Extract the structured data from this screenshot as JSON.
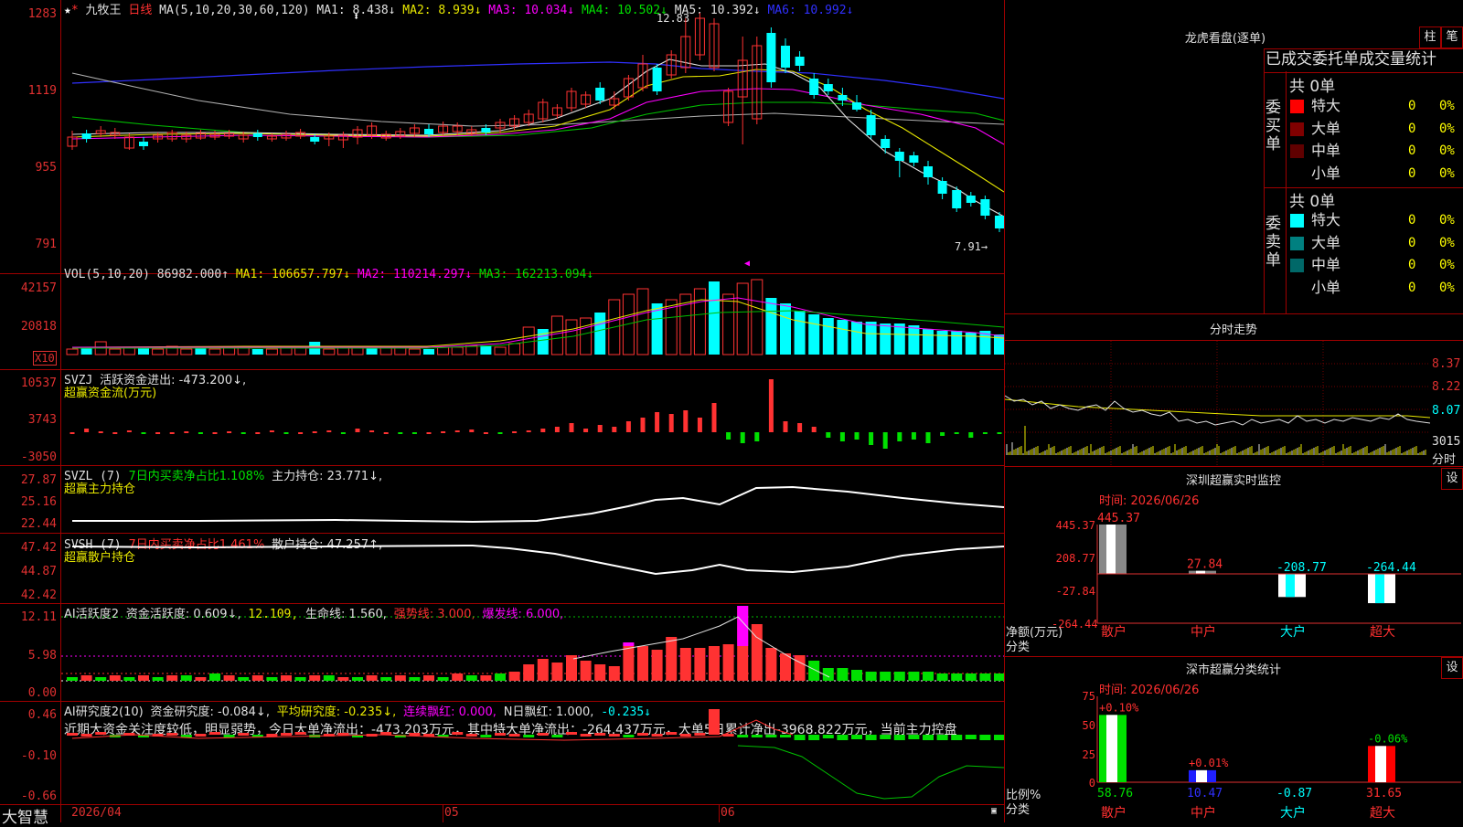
{
  "stock": {
    "name": "九牧王",
    "period": "日线"
  },
  "main": {
    "ma_params": "MA(5,10,20,30,60,120)",
    "ma1": "MA1: 8.438↓",
    "ma2": "MA2: 8.939↓",
    "ma3": "MA3: 10.034↓",
    "ma4": "MA4: 10.502↓",
    "ma5": "MA5: 10.392↓",
    "ma6": "MA6: 10.992↓",
    "y_labels": [
      "1283",
      "1119",
      "955",
      "791"
    ],
    "high_label": "12.83",
    "low_label": "7.91→"
  },
  "vol": {
    "params": "VOL(5,10,20)",
    "value": "86982.000↑",
    "ma1": "MA1: 106657.797↓",
    "ma2": "MA2: 110214.297↓",
    "ma3": "MA3: 162213.094↓",
    "y_labels": [
      "42157",
      "20818"
    ],
    "unit": "X10"
  },
  "svzj": {
    "label": "SVZJ",
    "text1": "活跃资金进出: -473.200↓,",
    "text2": "超赢资金流(万元)",
    "y_labels": [
      "10537",
      "3743",
      "-3050"
    ]
  },
  "svzl": {
    "label": "SVZL (7)",
    "text1": "7日内买卖净占比1.108%",
    "text2": "主力持仓: 23.771↓,",
    "text3": "超赢主力持仓",
    "y_labels": [
      "27.87",
      "25.16",
      "22.44"
    ]
  },
  "svsh": {
    "label": "SVSH (7)",
    "text1": "7日内买卖净占比1.461%",
    "text2": "散户持仓: 47.257↑,",
    "text3": "超赢散户持仓",
    "y_labels": [
      "47.42",
      "44.87",
      "42.42"
    ]
  },
  "ai_active": {
    "label": "AI活跃度2",
    "t1": "资金活跃度: 0.609↓,",
    "t2": "12.109,",
    "t3": "生命线: 1.560,",
    "t4": "强势线: 3.000,",
    "t5": "爆发线: 6.000,",
    "y_labels": [
      "12.11",
      "5.98",
      "0.00"
    ]
  },
  "ai_research": {
    "label": "AI研究度2(10)",
    "t1": "资金研究度: -0.084↓,",
    "t2": "平均研究度: -0.235↓,",
    "t3": "连续飘红: 0.000,",
    "t4": "N日飘红: 1.000,",
    "t5": "-0.235↓",
    "comment": "近期大资金关注度较低，明显弱势，今日大单净流出：-473.203万元，其中特大单净流出：-264.437万元，大单5日累计净出-3968.822万元，当前主力控盘",
    "y_labels": [
      "0.46",
      "-0.10",
      "-0.66"
    ]
  },
  "footer": {
    "brand": "大智慧",
    "date1": "2026/04",
    "month2": "05",
    "month3": "06"
  },
  "longhu": {
    "title": "龙虎看盘(逐单)",
    "btn1": "柱",
    "btn2": "笔",
    "subtitle": "已成交委托单成交量统计",
    "buy_label": "委买单",
    "sell_label": "委卖单",
    "buy_total": "共 0单",
    "sell_total": "共 0单",
    "buy_rows": [
      {
        "name": "特大",
        "count": "0",
        "pct": "0%",
        "color": "#ff0000"
      },
      {
        "name": "大单",
        "count": "0",
        "pct": "0%",
        "color": "#800000"
      },
      {
        "name": "中单",
        "count": "0",
        "pct": "0%",
        "color": "#600000"
      },
      {
        "name": "小单",
        "count": "0",
        "pct": "0%",
        "color": "#000000"
      }
    ],
    "sell_rows": [
      {
        "name": "特大",
        "count": "0",
        "pct": "0%",
        "color": "#00ffff"
      },
      {
        "name": "大单",
        "count": "0",
        "pct": "0%",
        "color": "#008080"
      },
      {
        "name": "中单",
        "count": "0",
        "pct": "0%",
        "color": "#006868"
      },
      {
        "name": "小单",
        "count": "0",
        "pct": "0%",
        "color": "#000000"
      }
    ]
  },
  "intraday": {
    "title": "分时走势",
    "y_labels": [
      "8.37",
      "8.22",
      "8.07"
    ],
    "vol_label": "3015",
    "unit": "分时"
  },
  "sz_monitor": {
    "title": "深圳超赢实时监控",
    "btn": "设",
    "time": "时间: 2026/06/26",
    "y_labels": [
      "445.37",
      "208.77",
      "-27.84",
      "-264.44"
    ],
    "ylabel1": "净额(万元)",
    "ylabel2": "分类",
    "categories": [
      "散户",
      "中户",
      "大户",
      "超大"
    ],
    "values": [
      445.37,
      27.84,
      -208.77,
      -264.44
    ],
    "value_labels": [
      "445.37",
      "27.84",
      "-208.77",
      "-264.44"
    ]
  },
  "sz_stats": {
    "title": "深市超赢分类统计",
    "btn": "设",
    "time": "时间: 2026/06/26",
    "y_labels": [
      "75",
      "50",
      "25",
      "0"
    ],
    "ylabel1": "比例%",
    "ylabel2": "分类",
    "categories": [
      "散户",
      "中户",
      "大户",
      "超大"
    ],
    "pct_values": [
      58.76,
      10.47,
      -0.87,
      31.65
    ],
    "bottom_labels": [
      "58.76",
      "10.47",
      "-0.87",
      "31.65"
    ],
    "change_labels": [
      "+0.10%",
      "+0.01%",
      "",
      "-0.06%"
    ]
  },
  "colors": {
    "up": "#ff3232",
    "down": "#00ffff",
    "grid_border": "#a00000"
  }
}
